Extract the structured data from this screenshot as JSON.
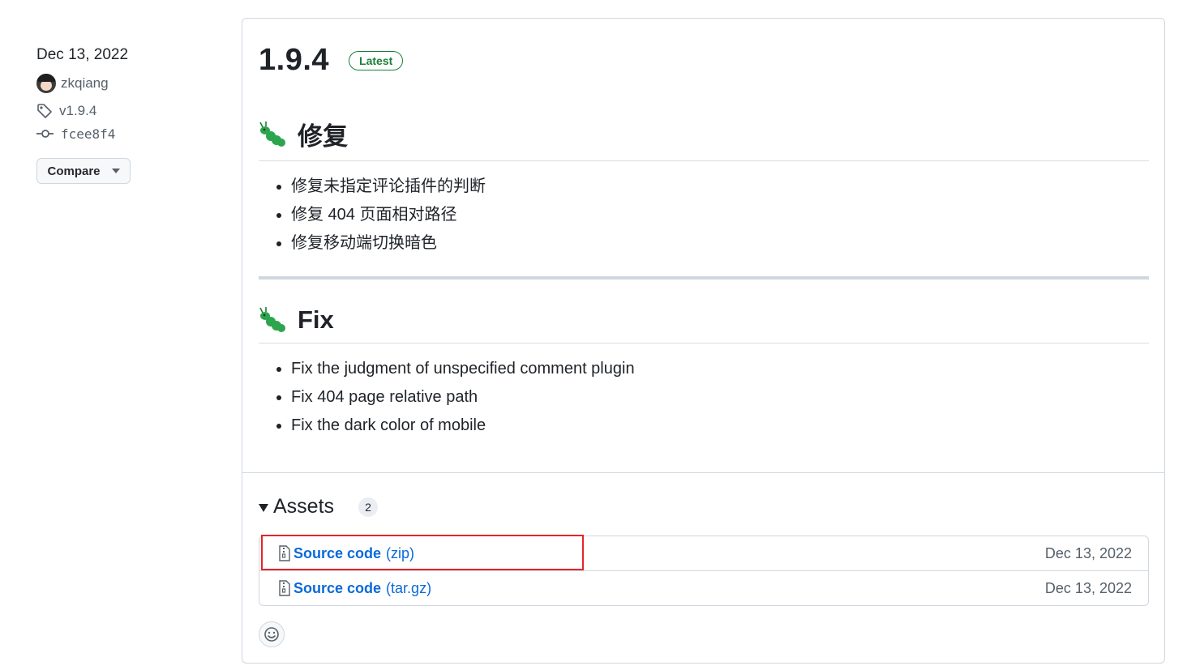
{
  "meta": {
    "date": "Dec 13, 2022",
    "author": "zkqiang",
    "tag": "v1.9.4",
    "commit": "fcee8f4",
    "compare_label": "Compare"
  },
  "release": {
    "version": "1.9.4",
    "badge": "Latest",
    "sections": [
      {
        "heading": "修复",
        "icon": "bug-icon",
        "items": [
          "修复未指定评论插件的判断",
          "修复 404 页面相对路径",
          "修复移动端切换暗色"
        ]
      },
      {
        "heading": "Fix",
        "icon": "bug-icon",
        "items": [
          "Fix the judgment of unspecified comment plugin",
          "Fix 404 page relative path",
          "Fix the dark color of mobile"
        ]
      }
    ]
  },
  "assets": {
    "title": "Assets",
    "count": "2",
    "items": [
      {
        "name": "Source code",
        "format": "(zip)",
        "date": "Dec 13, 2022",
        "highlighted": true
      },
      {
        "name": "Source code",
        "format": "(tar.gz)",
        "date": "Dec 13, 2022"
      }
    ]
  },
  "colors": {
    "accent": "#0969da",
    "latest_badge": "#1a7f37",
    "highlight": "#e5242b",
    "bug_green": "#2da44e"
  }
}
